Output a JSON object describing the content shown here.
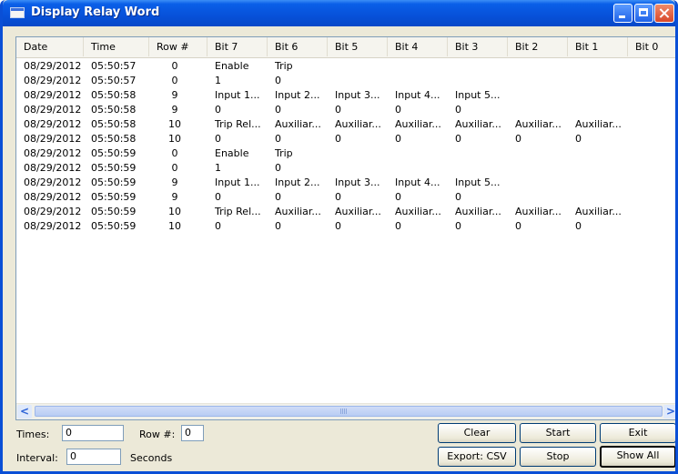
{
  "window": {
    "title": "Display Relay Word"
  },
  "columns": [
    "Date",
    "Time",
    "Row #",
    "Bit 7",
    "Bit 6",
    "Bit 5",
    "Bit 4",
    "Bit 3",
    "Bit 2",
    "Bit 1",
    "Bit 0"
  ],
  "rows": [
    [
      "08/29/2012",
      "05:50:57",
      "0",
      "Enable",
      "Trip",
      "",
      "",
      "",
      "",
      "",
      ""
    ],
    [
      "08/29/2012",
      "05:50:57",
      "0",
      "1",
      "0",
      "",
      "",
      "",
      "",
      "",
      ""
    ],
    [
      "08/29/2012",
      "05:50:58",
      "9",
      "Input 1...",
      "Input 2...",
      "Input 3...",
      "Input 4...",
      "Input 5...",
      "",
      "",
      ""
    ],
    [
      "08/29/2012",
      "05:50:58",
      "9",
      "0",
      "0",
      "0",
      "0",
      "0",
      "",
      "",
      ""
    ],
    [
      "08/29/2012",
      "05:50:58",
      "10",
      "Trip Rel...",
      "Auxiliar...",
      "Auxiliar...",
      "Auxiliar...",
      "Auxiliar...",
      "Auxiliar...",
      "Auxiliar...",
      ""
    ],
    [
      "08/29/2012",
      "05:50:58",
      "10",
      "0",
      "0",
      "0",
      "0",
      "0",
      "0",
      "0",
      ""
    ],
    [
      "08/29/2012",
      "05:50:59",
      "0",
      "Enable",
      "Trip",
      "",
      "",
      "",
      "",
      "",
      ""
    ],
    [
      "08/29/2012",
      "05:50:59",
      "0",
      "1",
      "0",
      "",
      "",
      "",
      "",
      "",
      ""
    ],
    [
      "08/29/2012",
      "05:50:59",
      "9",
      "Input 1...",
      "Input 2...",
      "Input 3...",
      "Input 4...",
      "Input 5...",
      "",
      "",
      ""
    ],
    [
      "08/29/2012",
      "05:50:59",
      "9",
      "0",
      "0",
      "0",
      "0",
      "0",
      "",
      "",
      ""
    ],
    [
      "08/29/2012",
      "05:50:59",
      "10",
      "Trip Rel...",
      "Auxiliar...",
      "Auxiliar...",
      "Auxiliar...",
      "Auxiliar...",
      "Auxiliar...",
      "Auxiliar...",
      ""
    ],
    [
      "08/29/2012",
      "05:50:59",
      "10",
      "0",
      "0",
      "0",
      "0",
      "0",
      "0",
      "0",
      ""
    ]
  ],
  "scrollbar": {
    "left_icon": "scroll-left-arrow-icon",
    "right_icon": "scroll-right-arrow-icon",
    "left_glyph": "<",
    "right_glyph": ">"
  },
  "controls": {
    "times_label": "Times:",
    "times_value": "0",
    "rownum_label": "Row #:",
    "rownum_value": "0",
    "interval_label": "Interval:",
    "interval_value": "0",
    "seconds_label": "Seconds"
  },
  "buttons": {
    "clear": "Clear",
    "start": "Start",
    "exit": "Exit",
    "export": "Export: CSV",
    "stop": "Stop",
    "show_all": "Show All"
  },
  "colors": {
    "titlebar": "#0751d9",
    "window_bg": "#ece9d8",
    "list_bg": "#ffffff"
  }
}
